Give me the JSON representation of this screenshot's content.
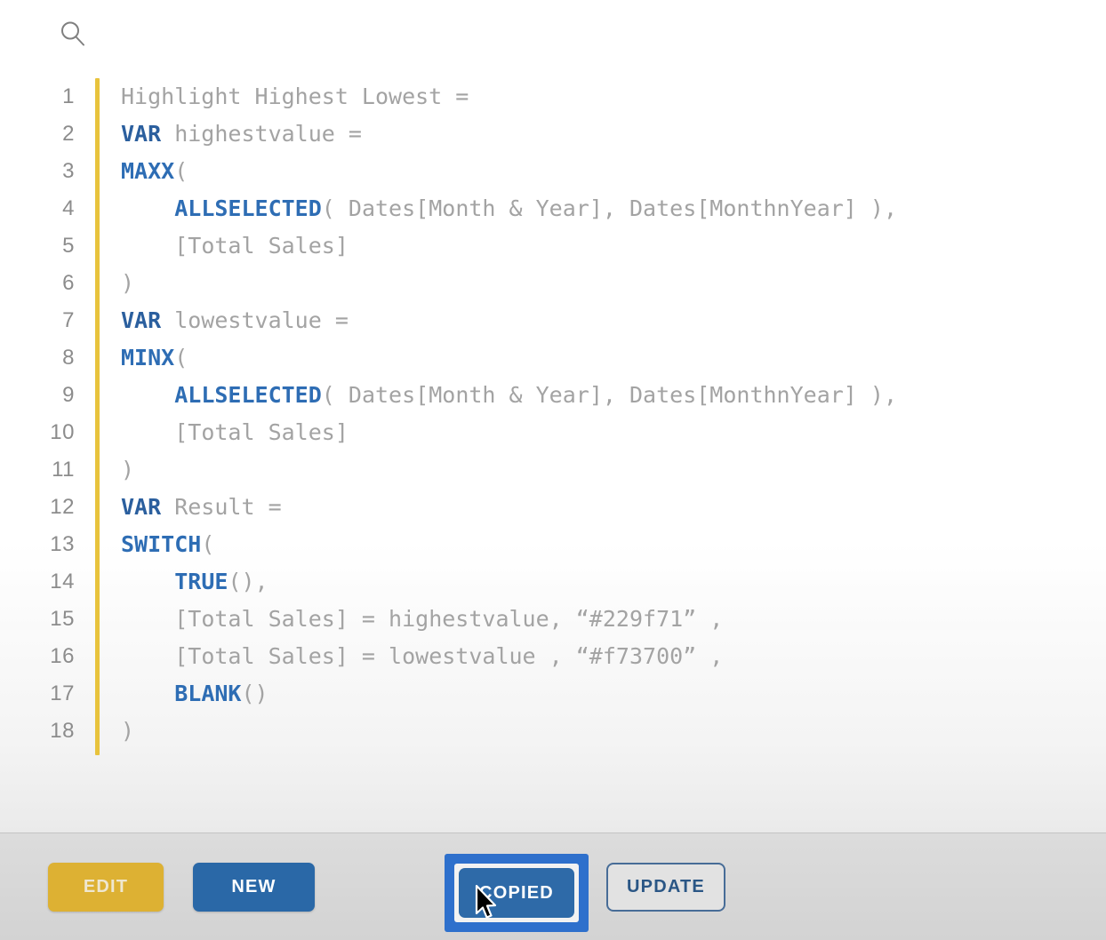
{
  "header": {
    "search_icon": "search-icon",
    "search_placeholder": ""
  },
  "editor": {
    "accent_color": "#e8c33c",
    "gutter_color": "#8c8c8c",
    "keyword_color": "#2b5f9e",
    "function_color": "#2e6db4",
    "text_color": "#a0a0a0",
    "lines": [
      {
        "n": "1",
        "indent": 0,
        "tokens": [
          {
            "t": "plain",
            "s": "Highlight Highest Lowest ="
          }
        ]
      },
      {
        "n": "2",
        "indent": 0,
        "tokens": [
          {
            "t": "kw",
            "s": "VAR"
          },
          {
            "t": "plain",
            "s": " highestvalue ="
          }
        ]
      },
      {
        "n": "3",
        "indent": 0,
        "tokens": [
          {
            "t": "fn",
            "s": "MAXX"
          },
          {
            "t": "punc",
            "s": "("
          }
        ]
      },
      {
        "n": "4",
        "indent": 1,
        "tokens": [
          {
            "t": "fn",
            "s": "ALLSELECTED"
          },
          {
            "t": "punc",
            "s": "( "
          },
          {
            "t": "plain",
            "s": "Dates[Month & Year], Dates[MonthnYear] ),"
          }
        ]
      },
      {
        "n": "5",
        "indent": 1,
        "tokens": [
          {
            "t": "plain",
            "s": "[Total Sales]"
          }
        ]
      },
      {
        "n": "6",
        "indent": 0,
        "tokens": [
          {
            "t": "punc",
            "s": ")"
          }
        ]
      },
      {
        "n": "7",
        "indent": 0,
        "tokens": [
          {
            "t": "kw",
            "s": "VAR"
          },
          {
            "t": "plain",
            "s": " lowestvalue ="
          }
        ]
      },
      {
        "n": "8",
        "indent": 0,
        "tokens": [
          {
            "t": "fn",
            "s": "MINX"
          },
          {
            "t": "punc",
            "s": "("
          }
        ]
      },
      {
        "n": "9",
        "indent": 1,
        "tokens": [
          {
            "t": "fn",
            "s": "ALLSELECTED"
          },
          {
            "t": "punc",
            "s": "( "
          },
          {
            "t": "plain",
            "s": "Dates[Month & Year], Dates[MonthnYear] ),"
          }
        ]
      },
      {
        "n": "10",
        "indent": 1,
        "tokens": [
          {
            "t": "plain",
            "s": "[Total Sales]"
          }
        ]
      },
      {
        "n": "11",
        "indent": 0,
        "tokens": [
          {
            "t": "punc",
            "s": ")"
          }
        ]
      },
      {
        "n": "12",
        "indent": 0,
        "tokens": [
          {
            "t": "kw",
            "s": "VAR"
          },
          {
            "t": "plain",
            "s": " Result ="
          }
        ]
      },
      {
        "n": "13",
        "indent": 0,
        "tokens": [
          {
            "t": "fn",
            "s": "SWITCH"
          },
          {
            "t": "punc",
            "s": "("
          }
        ]
      },
      {
        "n": "14",
        "indent": 1,
        "tokens": [
          {
            "t": "fn",
            "s": "TRUE"
          },
          {
            "t": "punc",
            "s": "(),"
          }
        ]
      },
      {
        "n": "15",
        "indent": 1,
        "tokens": [
          {
            "t": "plain",
            "s": "[Total Sales] = highestvalue, “#229f71” ,"
          }
        ]
      },
      {
        "n": "16",
        "indent": 1,
        "tokens": [
          {
            "t": "plain",
            "s": "[Total Sales] = lowestvalue , “#f73700” ,"
          }
        ]
      },
      {
        "n": "17",
        "indent": 1,
        "tokens": [
          {
            "t": "fn",
            "s": "BLANK"
          },
          {
            "t": "punc",
            "s": "()"
          }
        ]
      },
      {
        "n": "18",
        "indent": 0,
        "tokens": [
          {
            "t": "punc",
            "s": ")"
          }
        ]
      }
    ]
  },
  "footer": {
    "edit_label": "EDIT",
    "new_label": "NEW",
    "copied_label": "COPIED",
    "update_label": "UPDATE",
    "edit_color": "#ddb133",
    "new_color": "#2a68a7",
    "copied_color": "#2e6aa8",
    "focus_ring_color": "#2e70cc",
    "update_border_color": "#476c97",
    "update_text_color": "#2a5685"
  }
}
